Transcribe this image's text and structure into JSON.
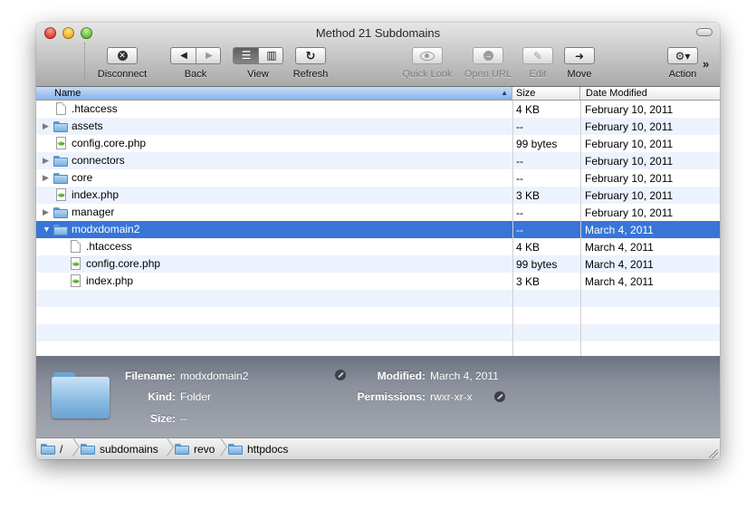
{
  "window": {
    "title": "Method 21 Subdomains"
  },
  "toolbar": {
    "disconnect": {
      "label": "Disconnect",
      "icon": "x-circle-icon"
    },
    "back": {
      "label": "Back",
      "icon_left": "◀",
      "icon_right": "▶"
    },
    "view": {
      "label": "View",
      "icon_list": "☰",
      "icon_columns": "▥"
    },
    "refresh": {
      "label": "Refresh",
      "icon": "↻"
    },
    "quick_look": {
      "label": "Quick Look",
      "icon": "eye-icon"
    },
    "open_url": {
      "label": "Open URL",
      "icon": "→"
    },
    "edit": {
      "label": "Edit",
      "icon": "✎"
    },
    "move": {
      "label": "Move",
      "icon": "➜"
    },
    "action": {
      "label": "Action",
      "icon": "⚙▾"
    },
    "overflow": "»"
  },
  "columns": {
    "name": "Name",
    "size": "Size",
    "date": "Date Modified",
    "sort_indicator": "▲"
  },
  "files": [
    {
      "name": ".htaccess",
      "size": "4 KB",
      "date": "February 10, 2011",
      "type": "file",
      "indent": 0,
      "disclosure": ""
    },
    {
      "name": "assets",
      "size": "--",
      "date": "February 10, 2011",
      "type": "folder",
      "indent": 0,
      "disclosure": "▶"
    },
    {
      "name": "config.core.php",
      "size": "99 bytes",
      "date": "February 10, 2011",
      "type": "php",
      "indent": 0,
      "disclosure": ""
    },
    {
      "name": "connectors",
      "size": "--",
      "date": "February 10, 2011",
      "type": "folder",
      "indent": 0,
      "disclosure": "▶"
    },
    {
      "name": "core",
      "size": "--",
      "date": "February 10, 2011",
      "type": "folder",
      "indent": 0,
      "disclosure": "▶"
    },
    {
      "name": "index.php",
      "size": "3 KB",
      "date": "February 10, 2011",
      "type": "php",
      "indent": 0,
      "disclosure": ""
    },
    {
      "name": "manager",
      "size": "--",
      "date": "February 10, 2011",
      "type": "folder",
      "indent": 0,
      "disclosure": "▶"
    },
    {
      "name": "modxdomain2",
      "size": "--",
      "date": "March 4, 2011",
      "type": "folder",
      "indent": 0,
      "disclosure": "▼",
      "selected": true
    },
    {
      "name": ".htaccess",
      "size": "4 KB",
      "date": "March 4, 2011",
      "type": "file",
      "indent": 1,
      "disclosure": ""
    },
    {
      "name": "config.core.php",
      "size": "99 bytes",
      "date": "March 4, 2011",
      "type": "php",
      "indent": 1,
      "disclosure": ""
    },
    {
      "name": "index.php",
      "size": "3 KB",
      "date": "March 4, 2011",
      "type": "php",
      "indent": 1,
      "disclosure": ""
    }
  ],
  "info": {
    "filename_label": "Filename:",
    "filename": "modxdomain2",
    "kind_label": "Kind:",
    "kind": "Folder",
    "size_label": "Size:",
    "size": "--",
    "modified_label": "Modified:",
    "modified": "March 4, 2011",
    "permissions_label": "Permissions:",
    "permissions": "rwxr-xr-x"
  },
  "path": [
    "/",
    "subdomains",
    "revo",
    "httpdocs"
  ],
  "colors": {
    "selection": "#3875d7",
    "alt_row": "#edf3fe"
  }
}
